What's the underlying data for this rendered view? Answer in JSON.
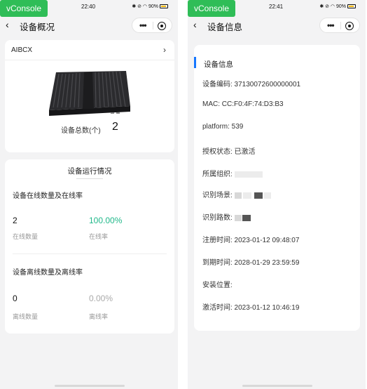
{
  "screen1": {
    "status": {
      "vconsole": "vConsole",
      "time": "22:40",
      "icons": "✱ ⊘ ◠ 90%"
    },
    "nav": {
      "title": "设备概况"
    },
    "device": {
      "name": "AIBCX",
      "total_label": "设备总数(个)",
      "total_value": "2"
    },
    "running": {
      "title": "设备运行情况",
      "online_section": "设备在线数量及在线率",
      "online_count": "2",
      "online_count_label": "在线数量",
      "online_rate": "100.00%",
      "online_rate_label": "在线率",
      "offline_section": "设备离线数量及离线率",
      "offline_count": "0",
      "offline_count_label": "离线数量",
      "offline_rate": "0.00%",
      "offline_rate_label": "离线率"
    },
    "colors": {
      "online_rate": "#20b88a",
      "offline_rate": "#aaaaaa"
    }
  },
  "screen2": {
    "status": {
      "vconsole": "vConsole",
      "time": "22:41",
      "icons": "✱ ⊘ ◠ 90%"
    },
    "nav": {
      "title": "设备信息"
    },
    "info": {
      "title": "设备信息",
      "code": "设备编码: 37130072600000001",
      "mac": "MAC: CC:F0:4F:74:D3:B3",
      "platform": "platform: 539",
      "auth": "授权状态: 已激活",
      "org": "所属组织:",
      "scene": "识别场景:",
      "channels": "识别路数:",
      "register": "注册时间: 2023-01-12 09:48:07",
      "expire": "到期时间: 2028-01-29 23:59:59",
      "location": "安装位置:",
      "activated": "激活时间: 2023-01-12 10:46:19"
    },
    "colors": {
      "accent": "#1677ff"
    }
  }
}
